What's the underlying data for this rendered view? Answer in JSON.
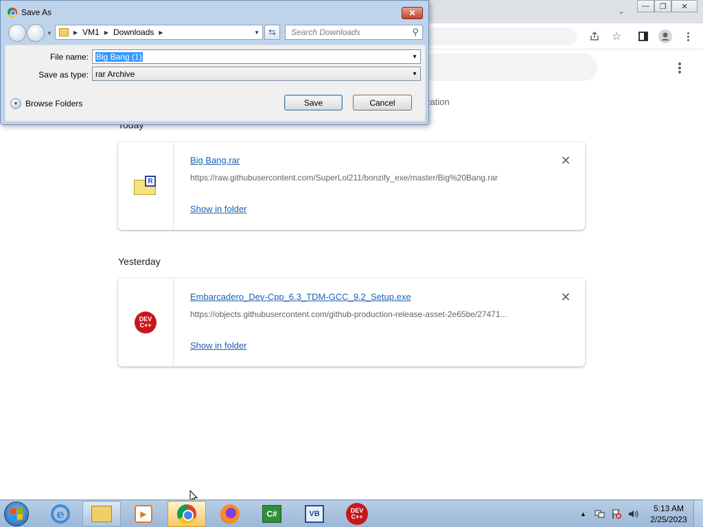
{
  "browser": {
    "window_controls": {
      "minimize": "—",
      "restore": "❐",
      "close": "✕"
    },
    "tab_list_icon": "chevron-down-icon",
    "toolbar_icons": [
      "share-icon",
      "star-icon",
      "side-panel-icon",
      "profile-icon",
      "kebab-menu-icon"
    ]
  },
  "downloads": {
    "behind_dialog_text": "zation",
    "sections": [
      {
        "label": "Today",
        "items": [
          {
            "file_name": "Big Bang.rar",
            "url": "https://raw.githubusercontent.com/SuperLol211/bonzify_exe/master/Big%20Bang.rar",
            "show_in_folder": "Show in folder",
            "icon": "rar-archive-icon",
            "close": "✕"
          }
        ]
      },
      {
        "label": "Yesterday",
        "items": [
          {
            "file_name": "Embarcadero_Dev-Cpp_6.3_TDM-GCC_9.2_Setup.exe",
            "url": "https://objects.githubusercontent.com/github-production-release-asset-2e65be/27471...",
            "show_in_folder": "Show in folder",
            "icon": "devcpp-icon",
            "icon_text_top": "DEV",
            "icon_text_bottom": "C++",
            "close": "✕"
          }
        ]
      }
    ]
  },
  "dialog": {
    "title": "Save As",
    "close": "✕",
    "breadcrumb": [
      "VM1",
      "Downloads"
    ],
    "search_placeholder": "Search Downloads",
    "file_name_label": "File name:",
    "file_name_value": "Big Bang (1)",
    "save_type_label": "Save as type:",
    "save_type_value": "rar Archive",
    "browse_folders": "Browse Folders",
    "save_label": "Save",
    "cancel_label": "Cancel"
  },
  "taskbar": {
    "apps": [
      "Internet Explorer",
      "Windows Explorer",
      "Windows Media Player",
      "Google Chrome",
      "Firefox",
      "C#",
      "Visual Basic",
      "Dev-C++"
    ],
    "cs_text": "C#",
    "vb_text": "VB",
    "devcpp_top": "DEV",
    "devcpp_bottom": "C++",
    "tray_arrow": "▲",
    "time": "5:13 AM",
    "date": "2/25/2023"
  },
  "colors": {
    "link": "#1a5fb4",
    "selection": "#3399ff",
    "devcpp_red": "#c8161d"
  }
}
